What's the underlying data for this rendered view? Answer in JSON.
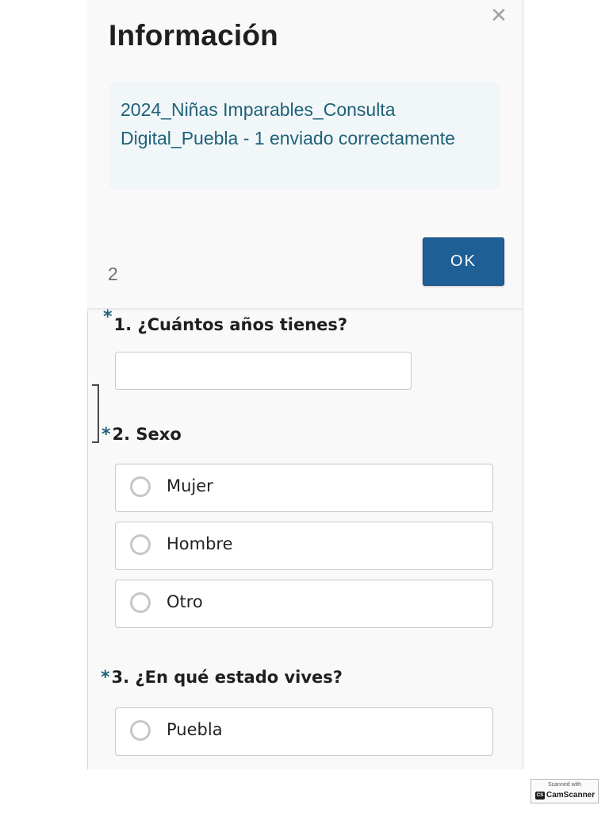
{
  "modal": {
    "title": "Información",
    "close_icon": "close-icon",
    "message": "2024_Niñas Imparables_Consulta Digital_Puebla - 1 enviado correctamente",
    "page_number": "2",
    "ok_label": "OK",
    "ok_color": "#1e5f95",
    "message_color": "#1f6279"
  },
  "form": {
    "questions": [
      {
        "asterisk": "*",
        "label": "1. ¿Cuántos años tienes?",
        "input_value": ""
      },
      {
        "asterisk": "*",
        "label": "2. Sexo",
        "options": [
          "Mujer",
          "Hombre",
          "Otro"
        ]
      },
      {
        "asterisk": "*",
        "label": "3. ¿En qué estado vives?",
        "options": [
          "Puebla"
        ]
      }
    ]
  },
  "watermark": {
    "top": "Scanned with",
    "logo": "CS",
    "brand": "CamScanner"
  }
}
